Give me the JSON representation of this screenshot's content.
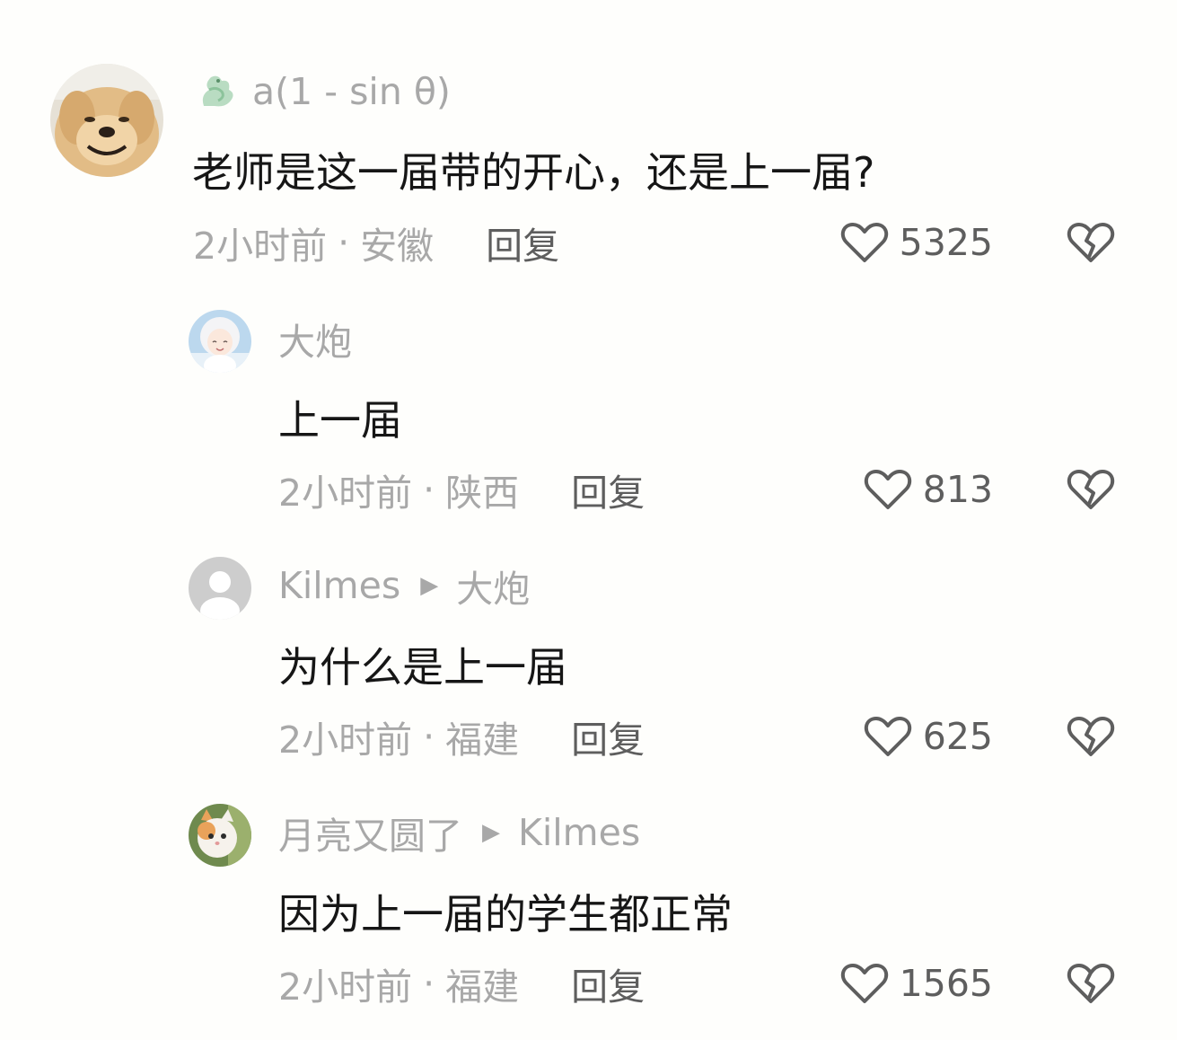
{
  "comments": [
    {
      "username": "a(1 - sin θ)",
      "reply_to": "",
      "text": "老师是这一届带的开心，还是上一届?",
      "time": "2小时前",
      "location": "安徽",
      "reply_label": "回复",
      "likes": "5325",
      "avatar_icon": "golden-retriever-avatar",
      "badge_icon": "dragon-icon"
    },
    {
      "username": "大炮",
      "reply_to": "",
      "text": "上一届",
      "time": "2小时前",
      "location": "陕西",
      "reply_label": "回复",
      "likes": "813",
      "avatar_icon": "anime-boy-avatar"
    },
    {
      "username": "Kilmes",
      "reply_to": "大炮",
      "text": "为什么是上一届",
      "time": "2小时前",
      "location": "福建",
      "reply_label": "回复",
      "likes": "625",
      "avatar_icon": "default-user-avatar"
    },
    {
      "username": "月亮又圆了",
      "reply_to": "Kilmes",
      "text": "因为上一届的学生都正常",
      "time": "2小时前",
      "location": "福建",
      "reply_label": "回复",
      "likes": "1565",
      "avatar_icon": "kitten-avatar"
    }
  ],
  "colors": {
    "background": "#fefefc",
    "primary_text": "#161616",
    "secondary_text": "#a8a8a8",
    "action_text": "#5e5e5e"
  }
}
